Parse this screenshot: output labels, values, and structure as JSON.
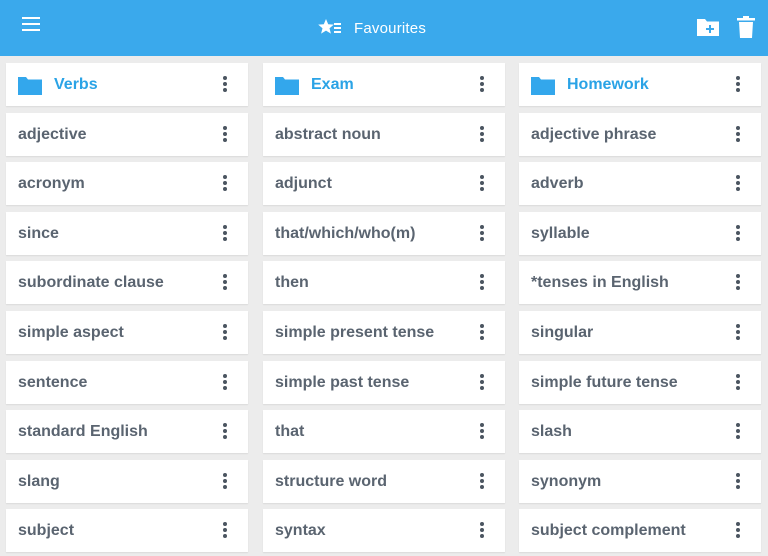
{
  "appbar": {
    "title": "Favourites",
    "icons": {
      "menu": "hamburger-menu-icon",
      "title": "star-list-icon",
      "new_folder": "new-folder-icon",
      "delete": "trash-icon"
    },
    "colors": {
      "background": "#3aa9ec",
      "foreground": "#ffffff"
    }
  },
  "columns": [
    {
      "folder": "Verbs",
      "items": [
        "adjective",
        "acronym",
        "since",
        "subordinate clause",
        "simple aspect",
        "sentence",
        "standard English",
        "slang",
        "subject"
      ]
    },
    {
      "folder": "Exam",
      "items": [
        "abstract noun",
        "adjunct",
        "that/which/who(m)",
        "then",
        "simple present tense",
        "simple past tense",
        "that",
        "structure word",
        "syntax"
      ]
    },
    {
      "folder": "Homework",
      "items": [
        "adjective phrase",
        "adverb",
        "syllable",
        "*tenses in English",
        "singular",
        "simple future tense",
        "slash",
        "synonym",
        "subject complement"
      ]
    }
  ],
  "colors": {
    "folder_title": "#2aa3e6",
    "folder_icon": "#33a7ec",
    "item_text": "#5a6470",
    "page_background": "#ececec"
  }
}
